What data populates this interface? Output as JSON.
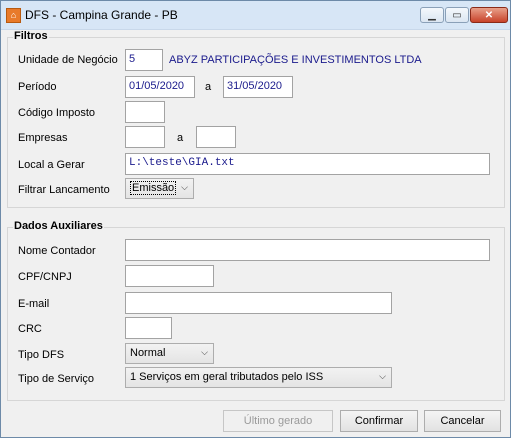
{
  "window": {
    "title": "DFS - Campina Grande - PB",
    "icon": "house-icon"
  },
  "filtros": {
    "title": "Filtros",
    "unidade_negocio": {
      "label": "Unidade de Negócio",
      "code": "5",
      "name": "ABYZ PARTICIPAÇÕES E INVESTIMENTOS LTDA"
    },
    "periodo": {
      "label": "Período",
      "from": "01/05/2020",
      "sep": "a",
      "to": "31/05/2020"
    },
    "codigo_imposto": {
      "label": "Código Imposto",
      "value": ""
    },
    "empresas": {
      "label": "Empresas",
      "from": "",
      "sep": "a",
      "to": ""
    },
    "local_gerar": {
      "label": "Local a Gerar",
      "value": "L:\\teste\\GIA.txt"
    },
    "filtrar_lancamento": {
      "label": "Filtrar Lancamento",
      "value": "Emissão"
    }
  },
  "dados": {
    "title": "Dados Auxiliares",
    "nome_contador": {
      "label": "Nome Contador",
      "value": ""
    },
    "cpf_cnpj": {
      "label": "CPF/CNPJ",
      "value": ""
    },
    "email": {
      "label": "E-mail",
      "value": ""
    },
    "crc": {
      "label": "CRC",
      "value": ""
    },
    "tipo_dfs": {
      "label": "Tipo DFS",
      "value": "Normal"
    },
    "tipo_servico": {
      "label": "Tipo de Serviço",
      "value": "1 Serviços em geral tributados pelo ISS"
    }
  },
  "buttons": {
    "ultimo": "Último gerado",
    "confirmar": "Confirmar",
    "cancelar": "Cancelar"
  }
}
